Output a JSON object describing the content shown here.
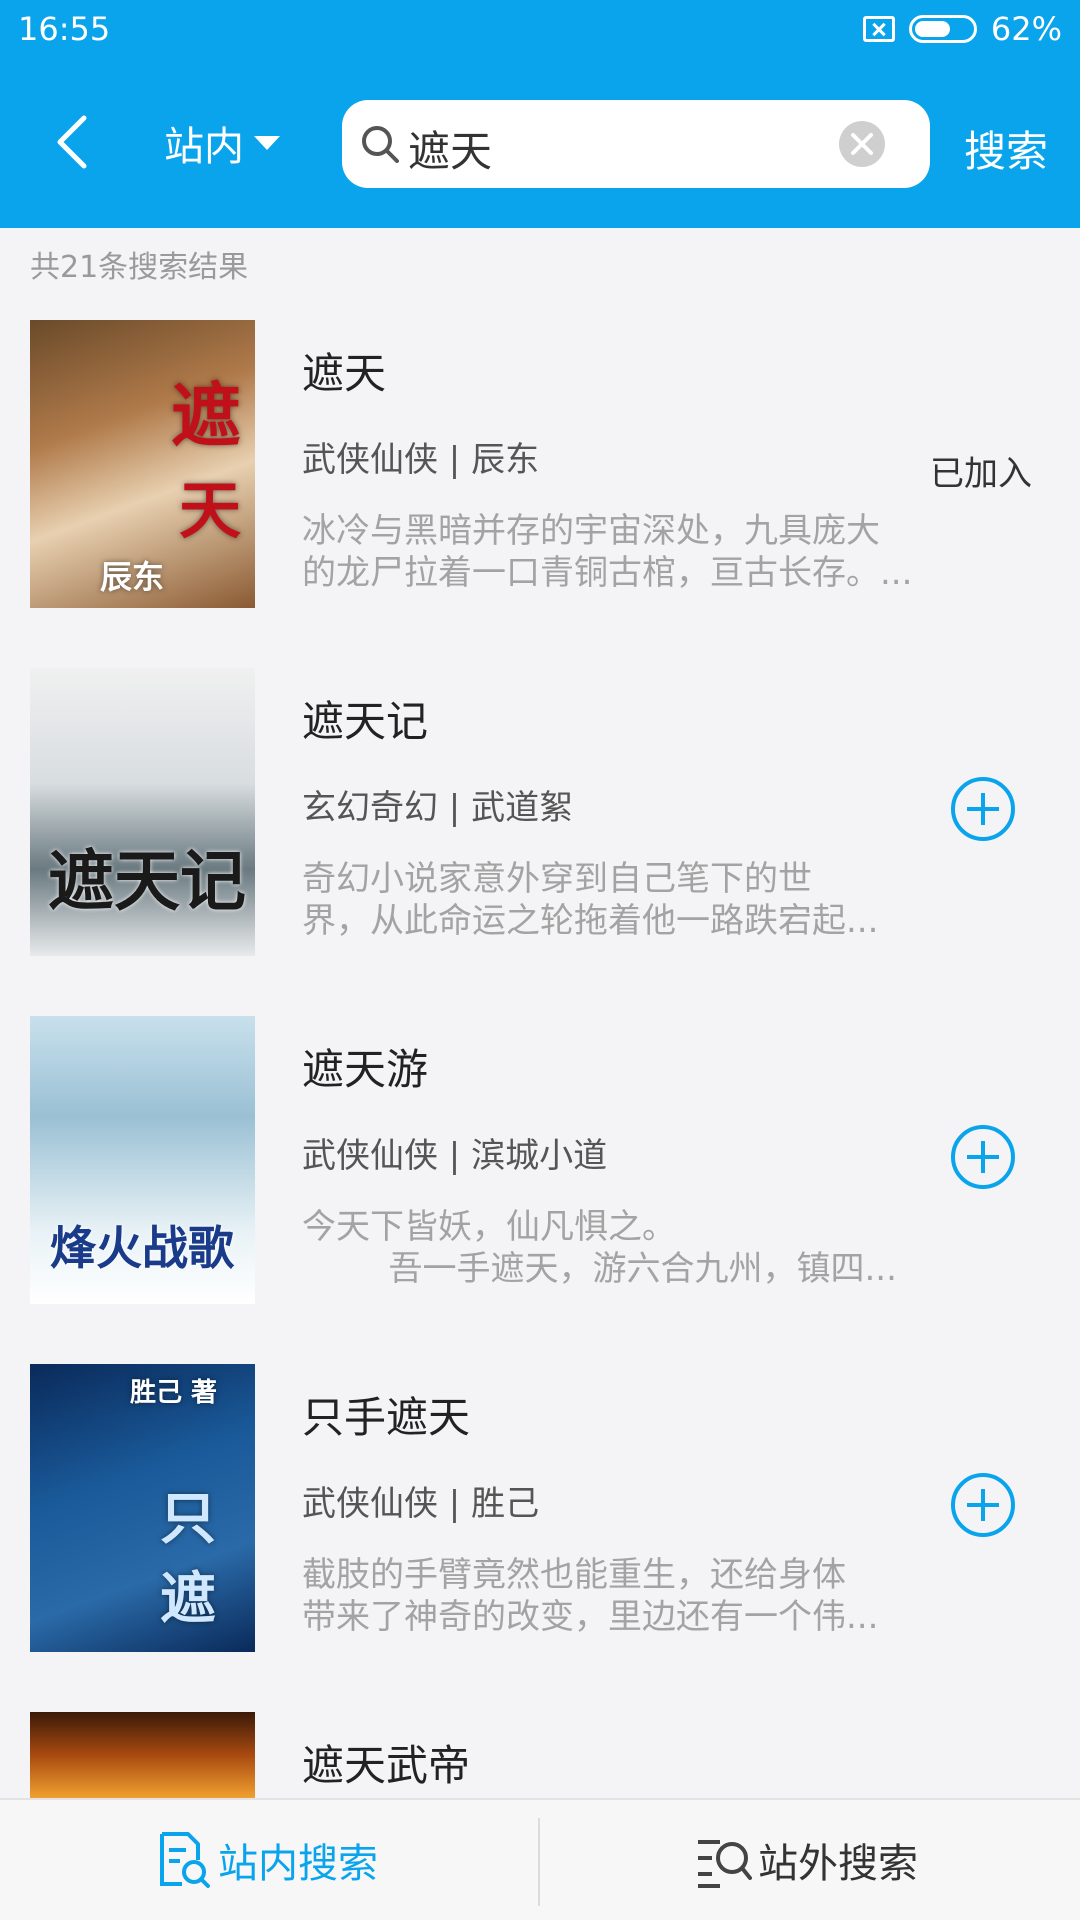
{
  "status_bar": {
    "time": "16:55",
    "battery": "62%"
  },
  "header": {
    "scope": "站内",
    "query": "遮天",
    "search_button": "搜索"
  },
  "results": {
    "count_label": "共21条搜索结果",
    "items": [
      {
        "title": "遮天",
        "meta": "武侠仙侠 | 辰东",
        "desc": "冰冷与黑暗并存的宇宙深处，九具庞大\n的龙尸拉着一口青铜古棺，亘古长存。...",
        "status": "已加入",
        "cover_text": "遮天 辰东著"
      },
      {
        "title": "遮天记",
        "meta": "玄幻奇幻 | 武道絮",
        "desc": "奇幻小说家意外穿到自己笔下的世\n界，从此命运之轮拖着他一路跌宕起...",
        "status": "add",
        "cover_text": "遮天记"
      },
      {
        "title": "遮天游",
        "meta": "武侠仙侠 | 滨城小道",
        "desc": "今天下皆妖，仙凡惧之。\n        吾一手遮天，游六合九州，镇四...",
        "status": "add",
        "cover_text": "烽火战歌"
      },
      {
        "title": "只手遮天",
        "meta": "武侠仙侠 | 胜己",
        "desc": "截肢的手臂竟然也能重生，还给身体\n带来了神奇的改变，里边还有一个伟...",
        "status": "add",
        "cover_text": "胜己 著"
      },
      {
        "title": "遮天武帝",
        "meta": "",
        "desc": "",
        "status": "",
        "cover_text": ""
      }
    ]
  },
  "bottom_bar": {
    "tab_inner": "站内搜索",
    "tab_outer": "站外搜索"
  },
  "colors": {
    "accent": "#0aa4ec",
    "background": "#f4f4f6"
  }
}
